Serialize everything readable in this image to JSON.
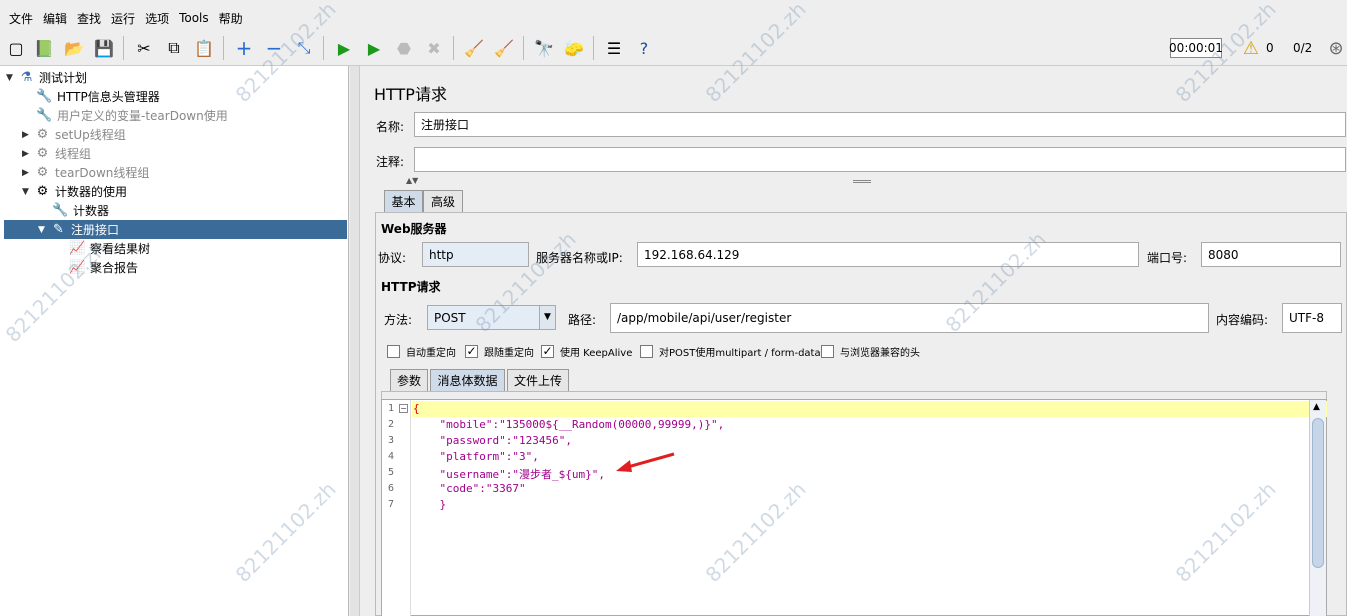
{
  "menu": [
    "文件",
    "编辑",
    "查找",
    "运行",
    "选项",
    "Tools",
    "帮助"
  ],
  "toolbar": {
    "timer": "00:00:01",
    "warnings": "0",
    "threads": "0/2"
  },
  "tree": {
    "root": "测试计划",
    "items": [
      {
        "label": "HTTP信息头管理器"
      },
      {
        "label": "用户定义的变量-tearDown使用"
      },
      {
        "label": "setUp线程组"
      },
      {
        "label": "线程组"
      },
      {
        "label": "tearDown线程组"
      },
      {
        "label": "计数器的使用"
      },
      {
        "label": "计数器"
      },
      {
        "label": "注册接口"
      },
      {
        "label": "察看结果树"
      },
      {
        "label": "聚合报告"
      }
    ]
  },
  "form": {
    "title": "HTTP请求",
    "name_label": "名称:",
    "name_value": "注册接口",
    "comment_label": "注释:",
    "comment_value": "",
    "tabs": [
      "基本",
      "高级"
    ],
    "web_server_title": "Web服务器",
    "protocol_label": "协议:",
    "protocol_value": "http",
    "server_label": "服务器名称或IP:",
    "server_value": "192.168.64.129",
    "port_label": "端口号:",
    "port_value": "8080",
    "http_request_title": "HTTP请求",
    "method_label": "方法:",
    "method_value": "POST",
    "path_label": "路径:",
    "path_value": "/app/mobile/api/user/register",
    "encoding_label": "内容编码:",
    "encoding_value": "UTF-8",
    "checkboxes": [
      {
        "label": "自动重定向",
        "checked": false
      },
      {
        "label": "跟随重定向",
        "checked": true
      },
      {
        "label": "使用 KeepAlive",
        "checked": true
      },
      {
        "label": "对POST使用multipart / form-data",
        "checked": false
      },
      {
        "label": "与浏览器兼容的头",
        "checked": false
      }
    ],
    "body_tabs": [
      "参数",
      "消息体数据",
      "文件上传"
    ]
  },
  "editor": {
    "lines": [
      {
        "n": "1",
        "text": "{"
      },
      {
        "n": "2",
        "text": "    \"mobile\":\"135000${__Random(00000,99999,)}\","
      },
      {
        "n": "3",
        "text": "    \"password\":\"123456\","
      },
      {
        "n": "4",
        "text": "    \"platform\":\"3\","
      },
      {
        "n": "5",
        "text": "    \"username\":\"漫步者_${um}\","
      },
      {
        "n": "6",
        "text": "    \"code\":\"3367\""
      },
      {
        "n": "7",
        "text": "    }"
      }
    ]
  },
  "watermark": "82121102.zh"
}
